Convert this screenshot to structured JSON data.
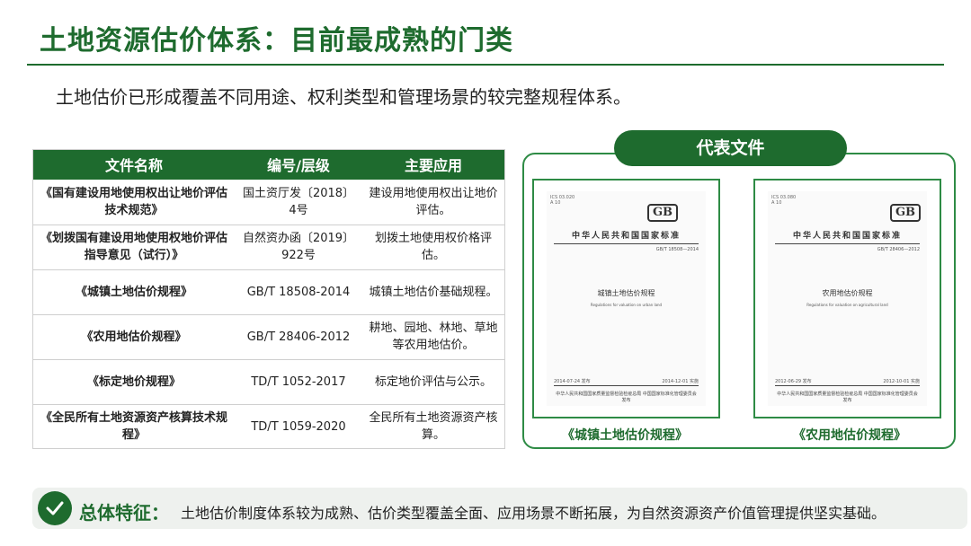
{
  "header": {
    "title": "土地资源估价体系：目前最成熟的门类",
    "subtitle": "土地估价已形成覆盖不同用途、权利类型和管理场景的较完整规程体系。"
  },
  "table": {
    "columns": [
      "文件名称",
      "编号/层级",
      "主要应用"
    ],
    "rows": [
      {
        "name": "《国有建设用地使用权出让地价评估技术规范》",
        "code": "国土资厅发〔2018〕4号",
        "use": "建设用地使用权出让地价评估。"
      },
      {
        "name": "《划拨国有建设用地使用权地价评估指导意见（试行）》",
        "code": "自然资办函〔2019〕922号",
        "use": "划拨土地使用权价格评估。"
      },
      {
        "name": "《城镇土地估价规程》",
        "code": "GB/T 18508-2014",
        "use": "城镇土地估价基础规程。"
      },
      {
        "name": "《农用地估价规程》",
        "code": "GB/T 28406-2012",
        "use": "耕地、园地、林地、草地等农用地估价。"
      },
      {
        "name": "《标定地价规程》",
        "code": "TD/T 1052-2017",
        "use": "标定地价评估与公示。"
      },
      {
        "name": "《全民所有土地资源资产核算技术规程》",
        "code": "TD/T 1059-2020",
        "use": "全民所有土地资源资产核算。"
      }
    ]
  },
  "panel": {
    "tab_label": "代表文件",
    "covers": [
      {
        "gb_mark": "GB",
        "head": "中华人民共和国国家标准",
        "std_no": "GB/T 18508—2014",
        "doc_name": "城镇土地估价规程",
        "doc_en": "Regulations for valuation on urban land",
        "date_left": "2014-07-24 发布",
        "date_right": "2014-12-01 实施",
        "publisher": "中华人民共和国国家质量监督检验检疫总局 中国国家标准化管理委员会 发布",
        "caption": "《城镇土地估价规程》"
      },
      {
        "gb_mark": "GB",
        "head": "中华人民共和国国家标准",
        "std_no": "GB/T 28406—2012",
        "doc_name": "农用地估价规程",
        "doc_en": "Regulations for valuation on agricultural land",
        "date_left": "2012-06-29 发布",
        "date_right": "2012-10-01 实施",
        "publisher": "中华人民共和国国家质量监督检验检疫总局 中国国家标准化管理委员会 发布",
        "caption": "《农用地估价规程》"
      }
    ]
  },
  "footer": {
    "icon": "check-circle-icon",
    "key": "总体特征：",
    "text": "土地估价制度体系较为成熟、估价类型覆盖全面、应用场景不断拓展，为自然资源资产价值管理提供坚实基础。"
  },
  "colors": {
    "accent": "#1e6b2e",
    "border": "#2e8b45",
    "footer_bg": "#eef1ee"
  }
}
